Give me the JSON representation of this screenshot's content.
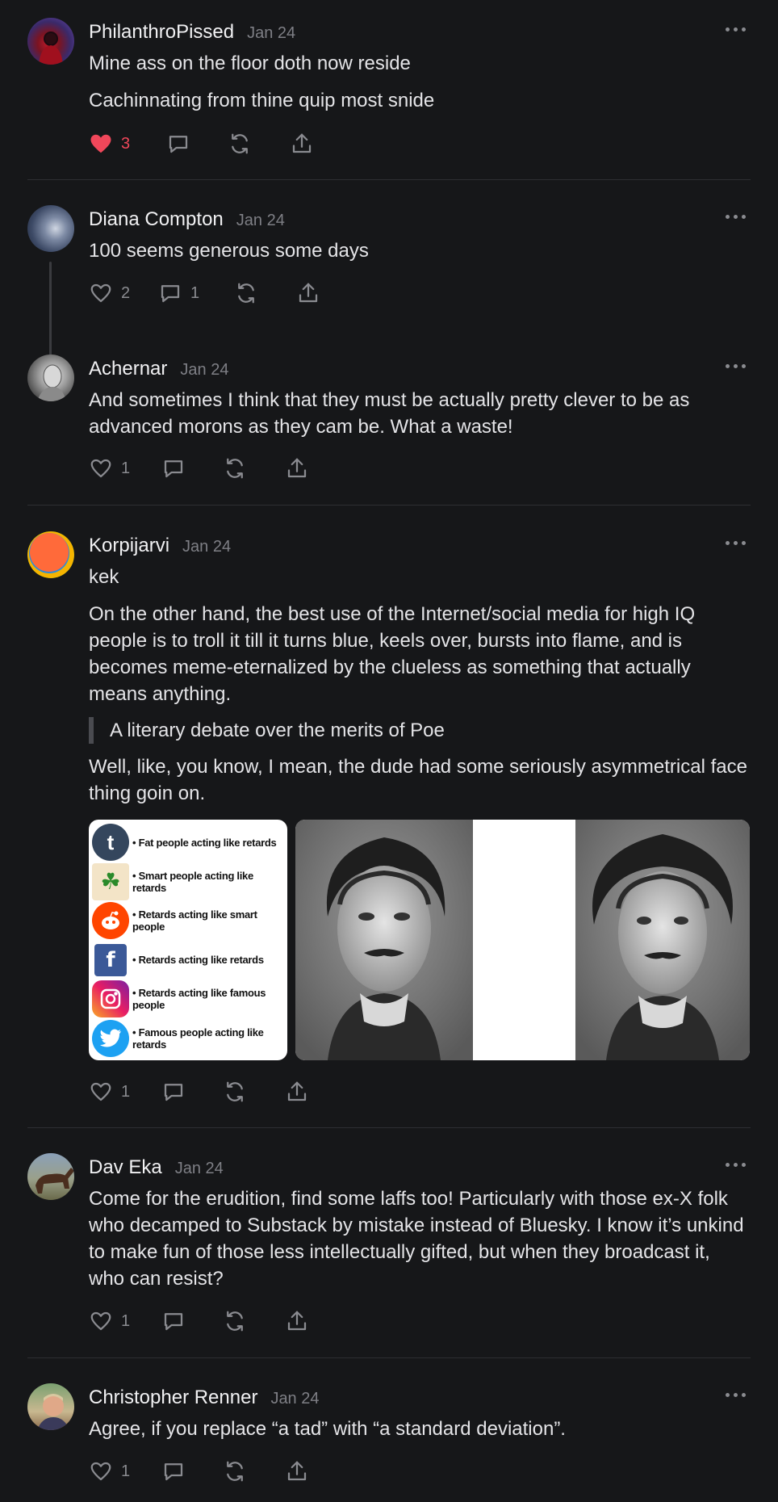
{
  "colors": {
    "background": "#161719",
    "liked": "#f0475a",
    "muted": "#8a8b90"
  },
  "posts": [
    {
      "name": "PhilanthroPissed",
      "date": "Jan 24",
      "paragraphs": [
        "Mine ass on the floor doth now reside",
        "Cachinnating from thine quip most snide"
      ],
      "likes": "3",
      "liked": true,
      "comments": ""
    },
    {
      "name": "Diana Compton",
      "date": "Jan 24",
      "paragraphs": [
        "100 seems generous some days"
      ],
      "likes": "2",
      "comments": "1"
    },
    {
      "name": "Achernar",
      "date": "Jan 24",
      "paragraphs": [
        "And sometimes I think that they must be actually pretty clever to be as advanced morons as they cam be. What a waste!"
      ],
      "likes": "1",
      "comments": ""
    },
    {
      "name": "Korpijarvi",
      "date": "Jan 24",
      "paragraphs": [
        "kek",
        "On the other hand, the best use of the Internet/social media for high IQ people is to troll it till it turns blue, keels over, bursts into flame, and is becomes meme-eternalized by the clueless as something that actually means anything."
      ],
      "quote": "A literary debate over the merits of Poe",
      "after_quote": "Well, like, you know, I mean, the dude had some seriously asymmetrical face thing goin on.",
      "meme_rows": [
        {
          "icon": "tumblr-icon",
          "text": "• Fat people acting like retards"
        },
        {
          "icon": "clover-icon",
          "text": "• Smart people acting like retards"
        },
        {
          "icon": "reddit-icon",
          "text": "• Retards acting like smart people"
        },
        {
          "icon": "facebook-icon",
          "text": "• Retards acting like retards"
        },
        {
          "icon": "instagram-icon",
          "text": "• Retards acting like famous people"
        },
        {
          "icon": "twitter-icon",
          "text": "• Famous people acting like retards"
        }
      ],
      "likes": "1",
      "comments": ""
    },
    {
      "name": "Dav Eka",
      "date": "Jan 24",
      "paragraphs": [
        "Come for the erudition, find some laffs too! Particularly with those ex-X folk who decamped to Substack by mistake instead of Bluesky. I know it’s unkind to make fun of those less intellectually gifted, but when they broadcast it, who can resist?"
      ],
      "likes": "1",
      "comments": ""
    },
    {
      "name": "Christopher Renner",
      "date": "Jan 24",
      "paragraphs": [
        "Agree, if you replace “a tad” with “a standard deviation”."
      ],
      "likes": "1",
      "comments": ""
    }
  ]
}
